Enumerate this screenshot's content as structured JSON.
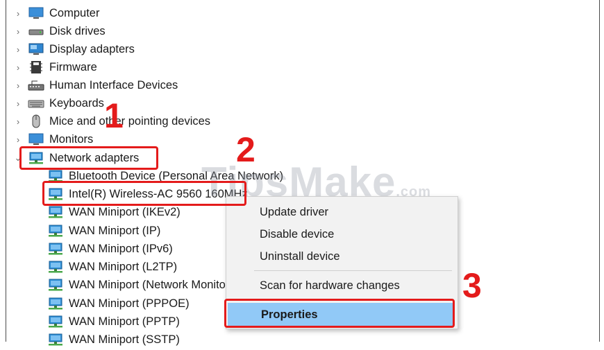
{
  "tree": {
    "categories": [
      {
        "label": "Computer",
        "icon": "computer-icon"
      },
      {
        "label": "Disk drives",
        "icon": "disk-drive-icon"
      },
      {
        "label": "Display adapters",
        "icon": "display-adapter-icon"
      },
      {
        "label": "Firmware",
        "icon": "firmware-icon"
      },
      {
        "label": "Human Interface Devices",
        "icon": "hid-icon"
      },
      {
        "label": "Keyboards",
        "icon": "keyboard-icon"
      },
      {
        "label": "Mice and other pointing devices",
        "icon": "mouse-icon"
      },
      {
        "label": "Monitors",
        "icon": "monitor-icon"
      },
      {
        "label": "Network adapters",
        "icon": "network-adapter-icon"
      }
    ],
    "network_children": [
      "Bluetooth Device (Personal Area Network)",
      "Intel(R) Wireless-AC 9560 160MHz",
      "WAN Miniport (IKEv2)",
      "WAN Miniport (IP)",
      "WAN Miniport (IPv6)",
      "WAN Miniport (L2TP)",
      "WAN Miniport (Network Monitor)",
      "WAN Miniport (PPPOE)",
      "WAN Miniport (PPTP)",
      "WAN Miniport (SSTP)"
    ]
  },
  "context_menu": {
    "update_driver": "Update driver",
    "disable_device": "Disable device",
    "uninstall_device": "Uninstall device",
    "scan_hardware": "Scan for hardware changes",
    "properties": "Properties"
  },
  "annotations": {
    "step1": "1",
    "step2": "2",
    "step3": "3"
  },
  "watermark": {
    "main": "TipsMake",
    "suffix": ".com"
  },
  "colors": {
    "callout": "#e41b1b",
    "selection": "#91c9f7",
    "network_icon": "#2f8fd6"
  }
}
